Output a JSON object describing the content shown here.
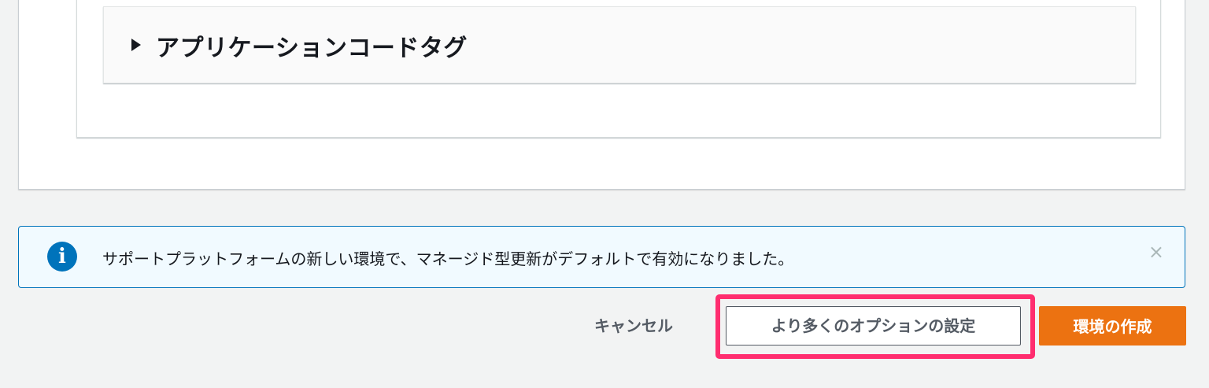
{
  "expandable_section": {
    "title": "アプリケーションコードタグ",
    "expanded": false
  },
  "info_banner": {
    "icon": "info-icon",
    "icon_glyph": "i",
    "message": "サポートプラットフォームの新しい環境で、マネージド型更新がデフォルトで有効になりました。",
    "close_glyph": "×"
  },
  "actions": {
    "cancel_label": "キャンセル",
    "more_options_label": "より多くのオプションの設定",
    "create_label": "環境の作成"
  },
  "colors": {
    "page_background": "#f2f3f3",
    "info_accent": "#0073bb",
    "info_background": "#f1faff",
    "primary_button": "#ec7211",
    "highlight_frame": "#ff2d6f",
    "secondary_text": "#545b64"
  }
}
